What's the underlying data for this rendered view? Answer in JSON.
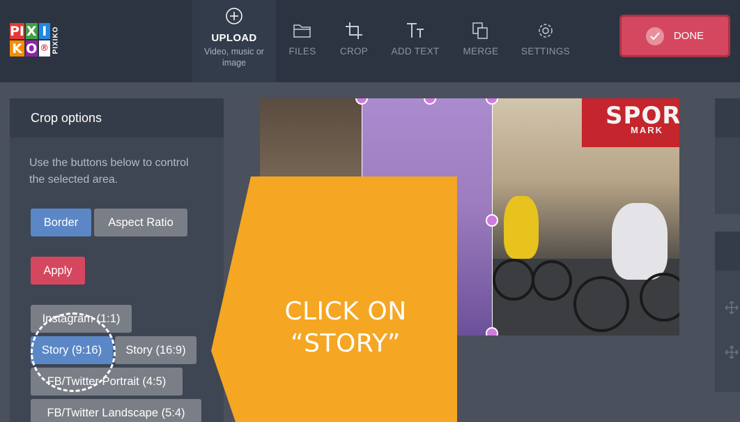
{
  "logo": {
    "letters": [
      "PI",
      "X",
      "I",
      "K",
      "O",
      "®"
    ],
    "side_text": "PIXIKO",
    "colors": [
      "#e53935",
      "#43a047",
      "#1e88e5",
      "#fb8c00",
      "#8e24aa",
      "#ffffff"
    ]
  },
  "toolbar": {
    "upload": {
      "label": "UPLOAD",
      "sub": "Video, music or image",
      "icon": "plus-circle-icon"
    },
    "files": {
      "label": "FILES",
      "icon": "folder-icon"
    },
    "crop": {
      "label": "CROP",
      "icon": "crop-icon"
    },
    "add_text": {
      "label": "ADD TEXT",
      "icon": "text-icon"
    },
    "merge": {
      "label": "MERGE",
      "icon": "merge-icon"
    },
    "settings": {
      "label": "SETTINGS",
      "icon": "gear-icon"
    },
    "done": {
      "label": "DONE",
      "icon": "check-icon"
    }
  },
  "crop_panel": {
    "title": "Crop options",
    "description": "Use the buttons below to control the selected area.",
    "mode_buttons": [
      "Border",
      "Aspect Ratio"
    ],
    "apply_label": "Apply",
    "presets": [
      "Instagram (1:1)",
      "Story (9:16)",
      "Story (16:9)",
      "FB/Twitter Portrait (4:5)",
      "FB/Twitter Landscape (5:4)"
    ]
  },
  "canvas": {
    "sign_text": "SPOR",
    "sign_sub": "MARK"
  },
  "callout": {
    "line1": "CLICK ON",
    "line2": "“STORY”",
    "color": "#f5a623"
  },
  "colors": {
    "topbar": "#2c3441",
    "accent_red": "#d5475e",
    "accent_blue": "#5b87c6",
    "crop_overlay": "#7846c8",
    "handle": "#cf7be0"
  }
}
